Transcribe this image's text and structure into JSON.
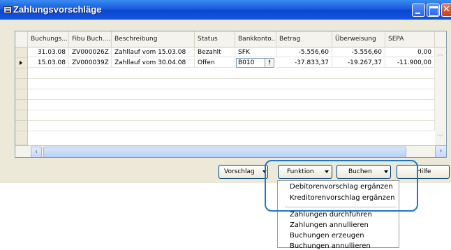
{
  "window": {
    "title": "Zahlungsvorschläge"
  },
  "grid": {
    "columns": [
      "Buchungs...",
      "Fibu Buch....",
      "Beschreibung",
      "Status",
      "Bankkonto...",
      "Betrag",
      "Überweisung",
      "SEPA"
    ],
    "rows": [
      {
        "buchungsdatum": "31.03.08",
        "fibu": "ZV000026Z",
        "beschreibung": "Zahllauf vom 15.03.08",
        "status": "Bezahlt",
        "bankkonto": "SFK",
        "betrag": "-5.556,60",
        "ueberweisung": "-5.556,60",
        "sepa": "0,00"
      },
      {
        "buchungsdatum": "15.03.08",
        "fibu": "ZV000039Z",
        "beschreibung": "Zahllauf vom 30.04.08",
        "status": "Offen",
        "bankkonto": "B010",
        "betrag": "-37.833,37",
        "ueberweisung": "-19.267,37",
        "sepa": "-11.900,00"
      }
    ],
    "lookup_icon": "arrow-up-icon"
  },
  "buttons": {
    "vorschlag": "Vorschlag",
    "funktion": "Funktion",
    "buchen": "Buchen",
    "hilfe": "Hilfe"
  },
  "menu": {
    "items": [
      "Debitorenvorschlag ergänzen",
      "Kreditorenvorschlag ergänzen",
      "Zahlungen durchführen",
      "Zahlungen annullieren",
      "Buchungen erzeugen",
      "Buchungen annullieren"
    ]
  },
  "colors": {
    "titlebar": "#0b47d0",
    "highlight": "#1c78c8"
  }
}
